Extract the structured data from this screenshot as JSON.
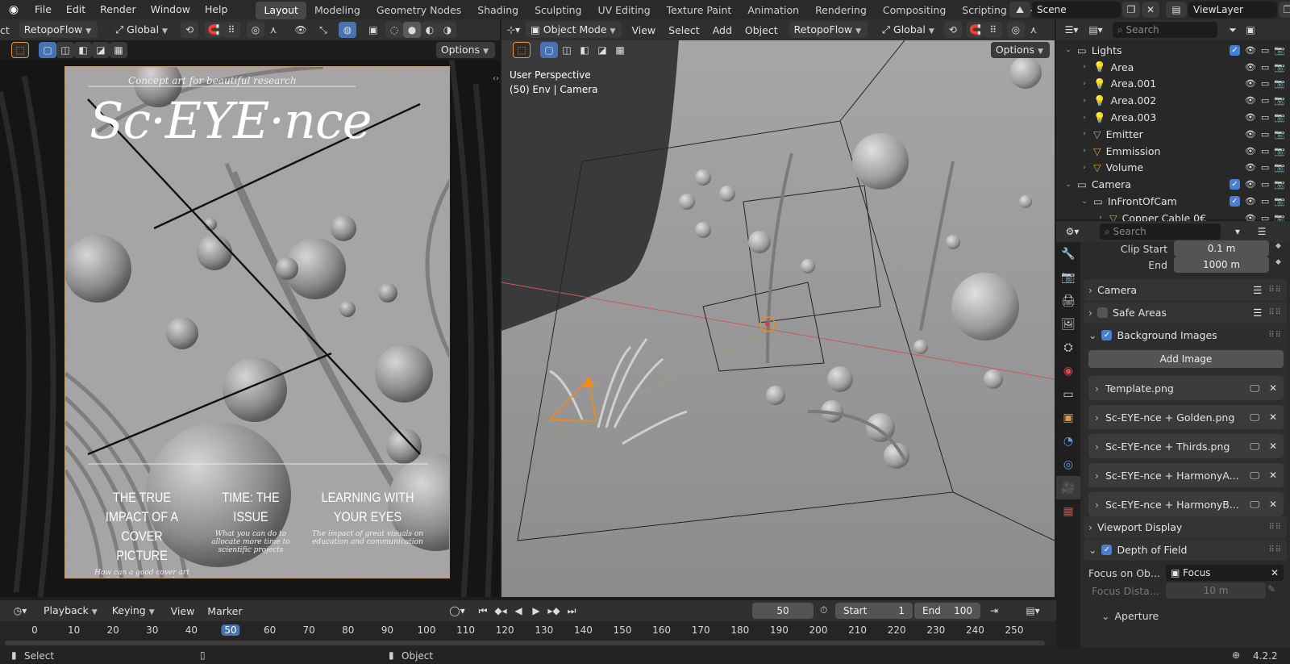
{
  "menubar": {
    "items": [
      "File",
      "Edit",
      "Render",
      "Window",
      "Help"
    ],
    "workspaces": [
      "Layout",
      "Modeling",
      "Geometry Nodes",
      "Shading",
      "Sculpting",
      "UV Editing",
      "Texture Paint",
      "Animation",
      "Rendering",
      "Compositing",
      "Scripting"
    ],
    "active_workspace": "Layout",
    "add_tab": "+",
    "scene": "Scene",
    "view_layer": "ViewLayer"
  },
  "left_editor": {
    "partial_label": "ct",
    "retopo": "RetopoFlow",
    "orientation": "Global",
    "options": "Options"
  },
  "cover": {
    "tagline": "Concept art for beautiful research",
    "title": "Sc·EYE·nce",
    "articles": [
      {
        "headline": "THE TRUE IMPACT OF A COVER PICTURE",
        "sub": "How can a good cover art help your research"
      },
      {
        "headline": "TIME: THE ISSUE",
        "sub": "What you can do to allocate more time to scientific projects"
      },
      {
        "headline": "LEARNING WITH YOUR EYES",
        "sub": "The impact of great visuals on education and communication"
      }
    ]
  },
  "viewport": {
    "mode": "Object Mode",
    "menus": [
      "View",
      "Select",
      "Add",
      "Object"
    ],
    "retopo": "RetopoFlow",
    "orientation": "Global",
    "options": "Options",
    "overlay_line1": "User Perspective",
    "overlay_line2": "(50) Env | Camera"
  },
  "outliner": {
    "search_placeholder": "Search",
    "rows": [
      {
        "label": "Lights",
        "indent": 0,
        "type": "collection",
        "expanded": true,
        "checkbox": true
      },
      {
        "label": "Area",
        "indent": 1,
        "type": "light"
      },
      {
        "label": "Area.001",
        "indent": 1,
        "type": "light"
      },
      {
        "label": "Area.002",
        "indent": 1,
        "type": "light"
      },
      {
        "label": "Area.003",
        "indent": 1,
        "type": "light"
      },
      {
        "label": "Emitter",
        "indent": 1,
        "type": "mesh"
      },
      {
        "label": "Emmission",
        "indent": 1,
        "type": "mesh"
      },
      {
        "label": "Volume",
        "indent": 1,
        "type": "mesh"
      },
      {
        "label": "Camera",
        "indent": 0,
        "type": "collection",
        "expanded": true,
        "checkbox": true
      },
      {
        "label": "InFrontOfCam",
        "indent": 1,
        "type": "collection",
        "expanded": true,
        "checkbox": true
      },
      {
        "label": "Copper Cable 0€",
        "indent": 2,
        "type": "mesh"
      }
    ]
  },
  "properties": {
    "search_placeholder": "Search",
    "clip_start_label": "Clip Start",
    "clip_start": "0.1 m",
    "clip_end_label": "End",
    "clip_end": "1000 m",
    "panels": {
      "camera": "Camera",
      "safe_areas": "Safe Areas",
      "background_images": "Background Images",
      "add_image": "Add Image",
      "viewport_display": "Viewport Display",
      "depth_of_field": "Depth of Field",
      "focus_on_object_label": "Focus on Ob...",
      "focus_object": "Focus",
      "focus_distance_label": "Focus Dista...",
      "focus_distance": "10 m",
      "aperture": "Aperture"
    },
    "background_images": [
      "Template.png",
      "Sc-EYE-nce + Golden.png",
      "Sc-EYE-nce + Thirds.png",
      "Sc-EYE-nce + HarmonyA...",
      "Sc-EYE-nce + HarmonyB..."
    ]
  },
  "timeline": {
    "menus": [
      "Playback",
      "Keying",
      "View",
      "Marker"
    ],
    "current_frame": "50",
    "start_label": "Start",
    "start": "1",
    "end_label": "End",
    "end": "100",
    "ticks": [
      "0",
      "10",
      "20",
      "30",
      "40",
      "50",
      "60",
      "70",
      "80",
      "90",
      "100",
      "110",
      "120",
      "130",
      "140",
      "150",
      "160",
      "170",
      "180",
      "190",
      "200",
      "210",
      "220",
      "230",
      "240",
      "250"
    ]
  },
  "statusbar": {
    "left": "Select",
    "mid": "Object",
    "version": "4.2.2"
  }
}
